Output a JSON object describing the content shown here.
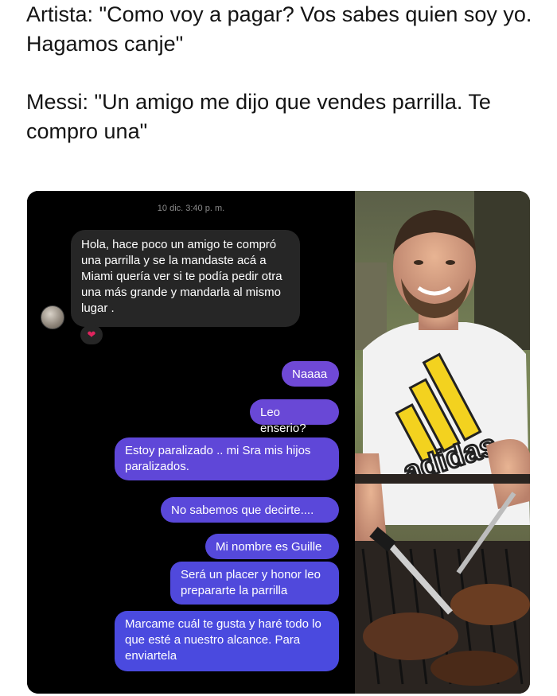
{
  "caption": {
    "line1": "Artista: \"Como voy a pagar? Vos sabes quien soy yo. Hagamos canje\"",
    "line2": "Messi: \"Un amigo me dijo que vendes parrilla. Te compro una\""
  },
  "chat": {
    "timestamp": "10 dic. 3:40 p. m.",
    "received": "Hola, hace poco un amigo te compró una parrilla y se la mandaste acá a Miami quería ver si te podía pedir otra una más grande y mandarla al mismo lugar .",
    "reaction": "❤",
    "sent": [
      "Naaaa",
      "Leo enserio?",
      "Estoy paralizado .. mi Sra mis hijos paralizados.",
      "No sabemos que decirte....",
      "Mi nombre es Guille",
      "Será un placer y honor leo prepararte la parrilla",
      "Marcame cuál te gusta y haré todo lo que esté a nuestro alcance. Para enviartela"
    ]
  },
  "photo": {
    "shirt_text": "adidas",
    "colors": {
      "shirt": "#f2f2f2",
      "stripes": "#f3d21f",
      "grill": "#2a2420"
    }
  }
}
